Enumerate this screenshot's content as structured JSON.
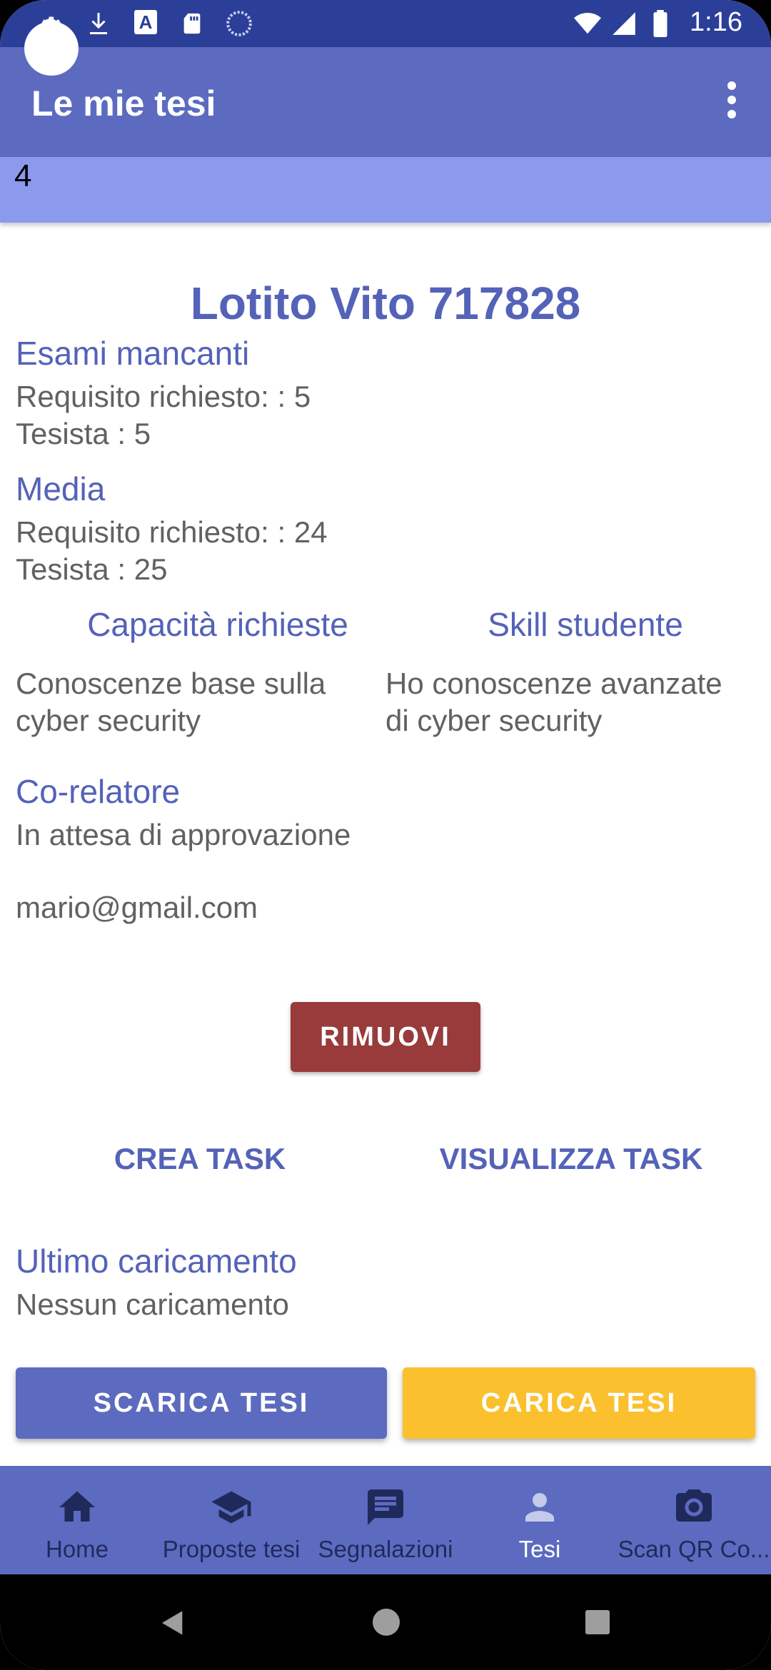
{
  "status_bar": {
    "time": "1:16",
    "icons": [
      "settings-icon",
      "download-icon",
      "text-badge-icon",
      "sd-card-icon",
      "loading-icon",
      "wifi-icon",
      "signal-icon",
      "battery-icon"
    ],
    "text_badge": "A"
  },
  "app_bar": {
    "title": "Le mie tesi",
    "menu_icon": "more-vert-icon"
  },
  "selected_band": {
    "value": "4"
  },
  "student": {
    "name": "Lotito Vito 717828"
  },
  "exams": {
    "label": "Esami mancanti",
    "required": "Requisito richiesto: : 5",
    "student": "Tesista : 5"
  },
  "average": {
    "label": "Media",
    "required": "Requisito richiesto: : 24",
    "student": "Tesista : 25"
  },
  "skills": {
    "required_label": "Capacità richieste",
    "student_label": "Skill studente",
    "required_line1": "Conoscenze base sulla",
    "required_line2": "cyber security",
    "student_line1": "Ho conoscenze avanzate",
    "student_line2": "di cyber security"
  },
  "corelator": {
    "label": "Co-relatore",
    "status": "In attesa di approvazione",
    "email": "mario@gmail.com"
  },
  "actions": {
    "remove": "RIMUOVI",
    "create_task": "CREA TASK",
    "view_task": "VISUALIZZA TASK"
  },
  "upload": {
    "label": "Ultimo caricamento",
    "value": "Nessun caricamento",
    "download_button": "SCARICA TESI",
    "upload_button": "CARICA TESI"
  },
  "bottom_nav": {
    "items": [
      {
        "label": "Home",
        "icon": "home-icon"
      },
      {
        "label": "Proposte tesi",
        "icon": "graduation-cap-icon"
      },
      {
        "label": "Segnalazioni",
        "icon": "message-icon"
      },
      {
        "label": "Tesi",
        "icon": "person-icon"
      },
      {
        "label": "Scan QR Co...",
        "icon": "camera-icon"
      }
    ]
  },
  "colors": {
    "status_bar": "#2b3f99",
    "primary": "#5c6bc0",
    "accent_text": "#5462b8",
    "band": "#8c9aee",
    "remove_button": "#993b3b",
    "upload_button": "#fbc02d"
  }
}
